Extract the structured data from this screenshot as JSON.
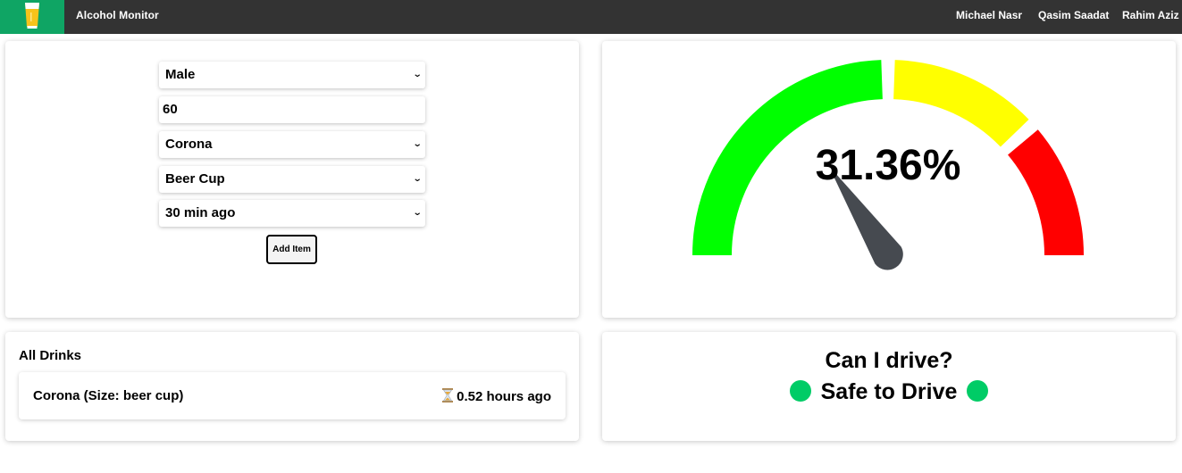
{
  "header": {
    "app_title": "Alcohol Monitor",
    "logo_icon": "beer-glass-icon",
    "brand_color": "#0fa564",
    "nav": [
      "Michael Nasr",
      "Qasim Saadat",
      "Rahim Aziz"
    ]
  },
  "form": {
    "gender": "Male",
    "weight": "60",
    "drink": "Corona",
    "size": "Beer Cup",
    "time": "30 min ago",
    "add_label": "Add Item"
  },
  "gauge": {
    "value_text": "31.36%",
    "value_percent": 31.36,
    "zones": [
      {
        "name": "safe",
        "color": "#00ff00"
      },
      {
        "name": "caution",
        "color": "#ffff00"
      },
      {
        "name": "danger",
        "color": "#ff0000"
      }
    ],
    "needle_color": "#464a50"
  },
  "drinks": {
    "title": "All Drinks",
    "items": [
      {
        "name": "Corona (Size: beer cup)",
        "time": "0.52 hours ago",
        "icon": "hourglass-icon"
      }
    ]
  },
  "drive": {
    "question": "Can I drive?",
    "status": "Safe to Drive",
    "status_color": "#00cc66"
  }
}
